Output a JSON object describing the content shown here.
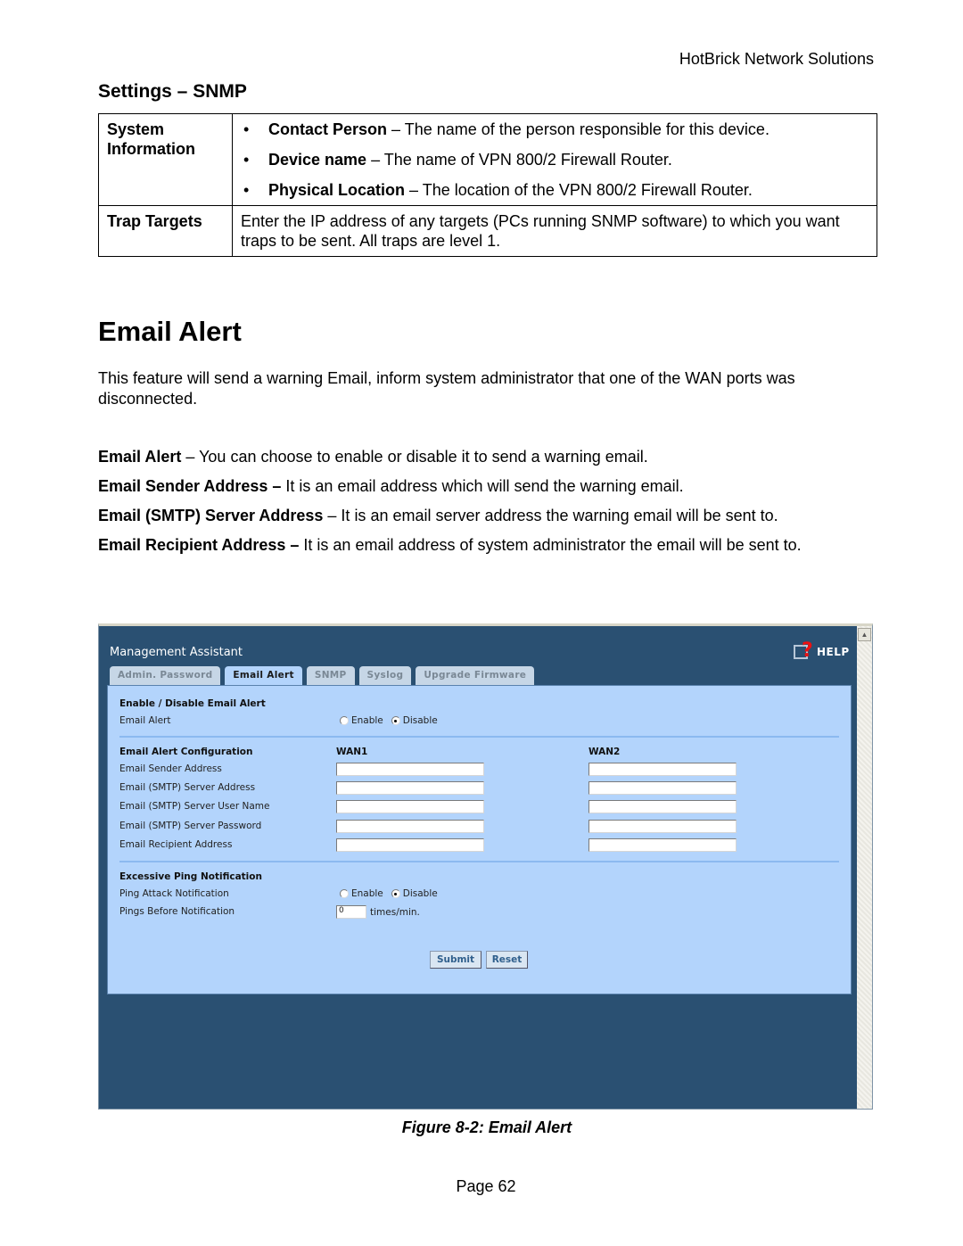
{
  "header": {
    "company": "HotBrick Network Solutions"
  },
  "snmp_section": {
    "title": "Settings – SNMP",
    "rows": [
      {
        "label": "System Information",
        "bullets": [
          {
            "term": "Contact Person",
            "desc": " – The name of the person responsible for this device."
          },
          {
            "term": "Device name",
            "desc": " – The name of VPN 800/2 Firewall Router."
          },
          {
            "term": "Physical Location",
            "desc": " – The location of the  VPN 800/2 Firewall Router."
          }
        ]
      },
      {
        "label": "Trap Targets",
        "text": "Enter the IP address of any targets (PCs running SNMP software) to which you want traps to be sent. All traps are level 1."
      }
    ]
  },
  "email_section": {
    "title": "Email Alert",
    "intro": "This feature will send a warning Email, inform system administrator that one of the WAN ports was disconnected.",
    "definitions": [
      {
        "term": "Email Alert",
        "desc": " – You can choose to enable or disable it to send a warning email."
      },
      {
        "term": "Email Sender Address –",
        "desc": " It is an email address which will send the warning email."
      },
      {
        "term": "Email (SMTP) Server Address",
        "desc": " – It is an email server address the warning email will be sent to."
      },
      {
        "term": "Email Recipient Address –",
        "desc": " It is an email address of system administrator the email will be sent to."
      }
    ]
  },
  "screenshot": {
    "app_title": "Management Assistant",
    "help_label": "HELP",
    "tabs": [
      {
        "label": "Admin. Password",
        "active": false
      },
      {
        "label": "Email Alert",
        "active": true
      },
      {
        "label": "SNMP",
        "active": false
      },
      {
        "label": "Syslog",
        "active": false
      },
      {
        "label": "Upgrade Firmware",
        "active": false
      }
    ],
    "enable_section": {
      "heading": "Enable / Disable Email Alert",
      "field_label": "Email Alert",
      "options": [
        "Enable",
        "Disable"
      ],
      "selected": "Disable"
    },
    "config_section": {
      "heading": "Email Alert Configuration",
      "col1": "WAN1",
      "col2": "WAN2",
      "fields": [
        {
          "label": "Email Sender Address",
          "wan1": "",
          "wan2": ""
        },
        {
          "label": "Email (SMTP) Server Address",
          "wan1": "",
          "wan2": ""
        },
        {
          "label": "Email (SMTP) Server User Name",
          "wan1": "",
          "wan2": ""
        },
        {
          "label": "Email (SMTP) Server Password",
          "wan1": "",
          "wan2": ""
        },
        {
          "label": "Email Recipient Address",
          "wan1": "",
          "wan2": ""
        }
      ]
    },
    "ping_section": {
      "heading": "Excessive Ping Notification",
      "attack_label": "Ping Attack Notification",
      "options": [
        "Enable",
        "Disable"
      ],
      "selected": "Disable",
      "pings_label": "Pings Before Notification",
      "pings_value": "0",
      "pings_unit": "times/min."
    },
    "buttons": {
      "submit": "Submit",
      "reset": "Reset"
    },
    "colors": {
      "frame": "#2a5072",
      "panel": "#b3d4fc",
      "button_text": "#2f5f8c"
    }
  },
  "figure_caption": "Figure 8-2: Email Alert",
  "page_label": "Page 62"
}
